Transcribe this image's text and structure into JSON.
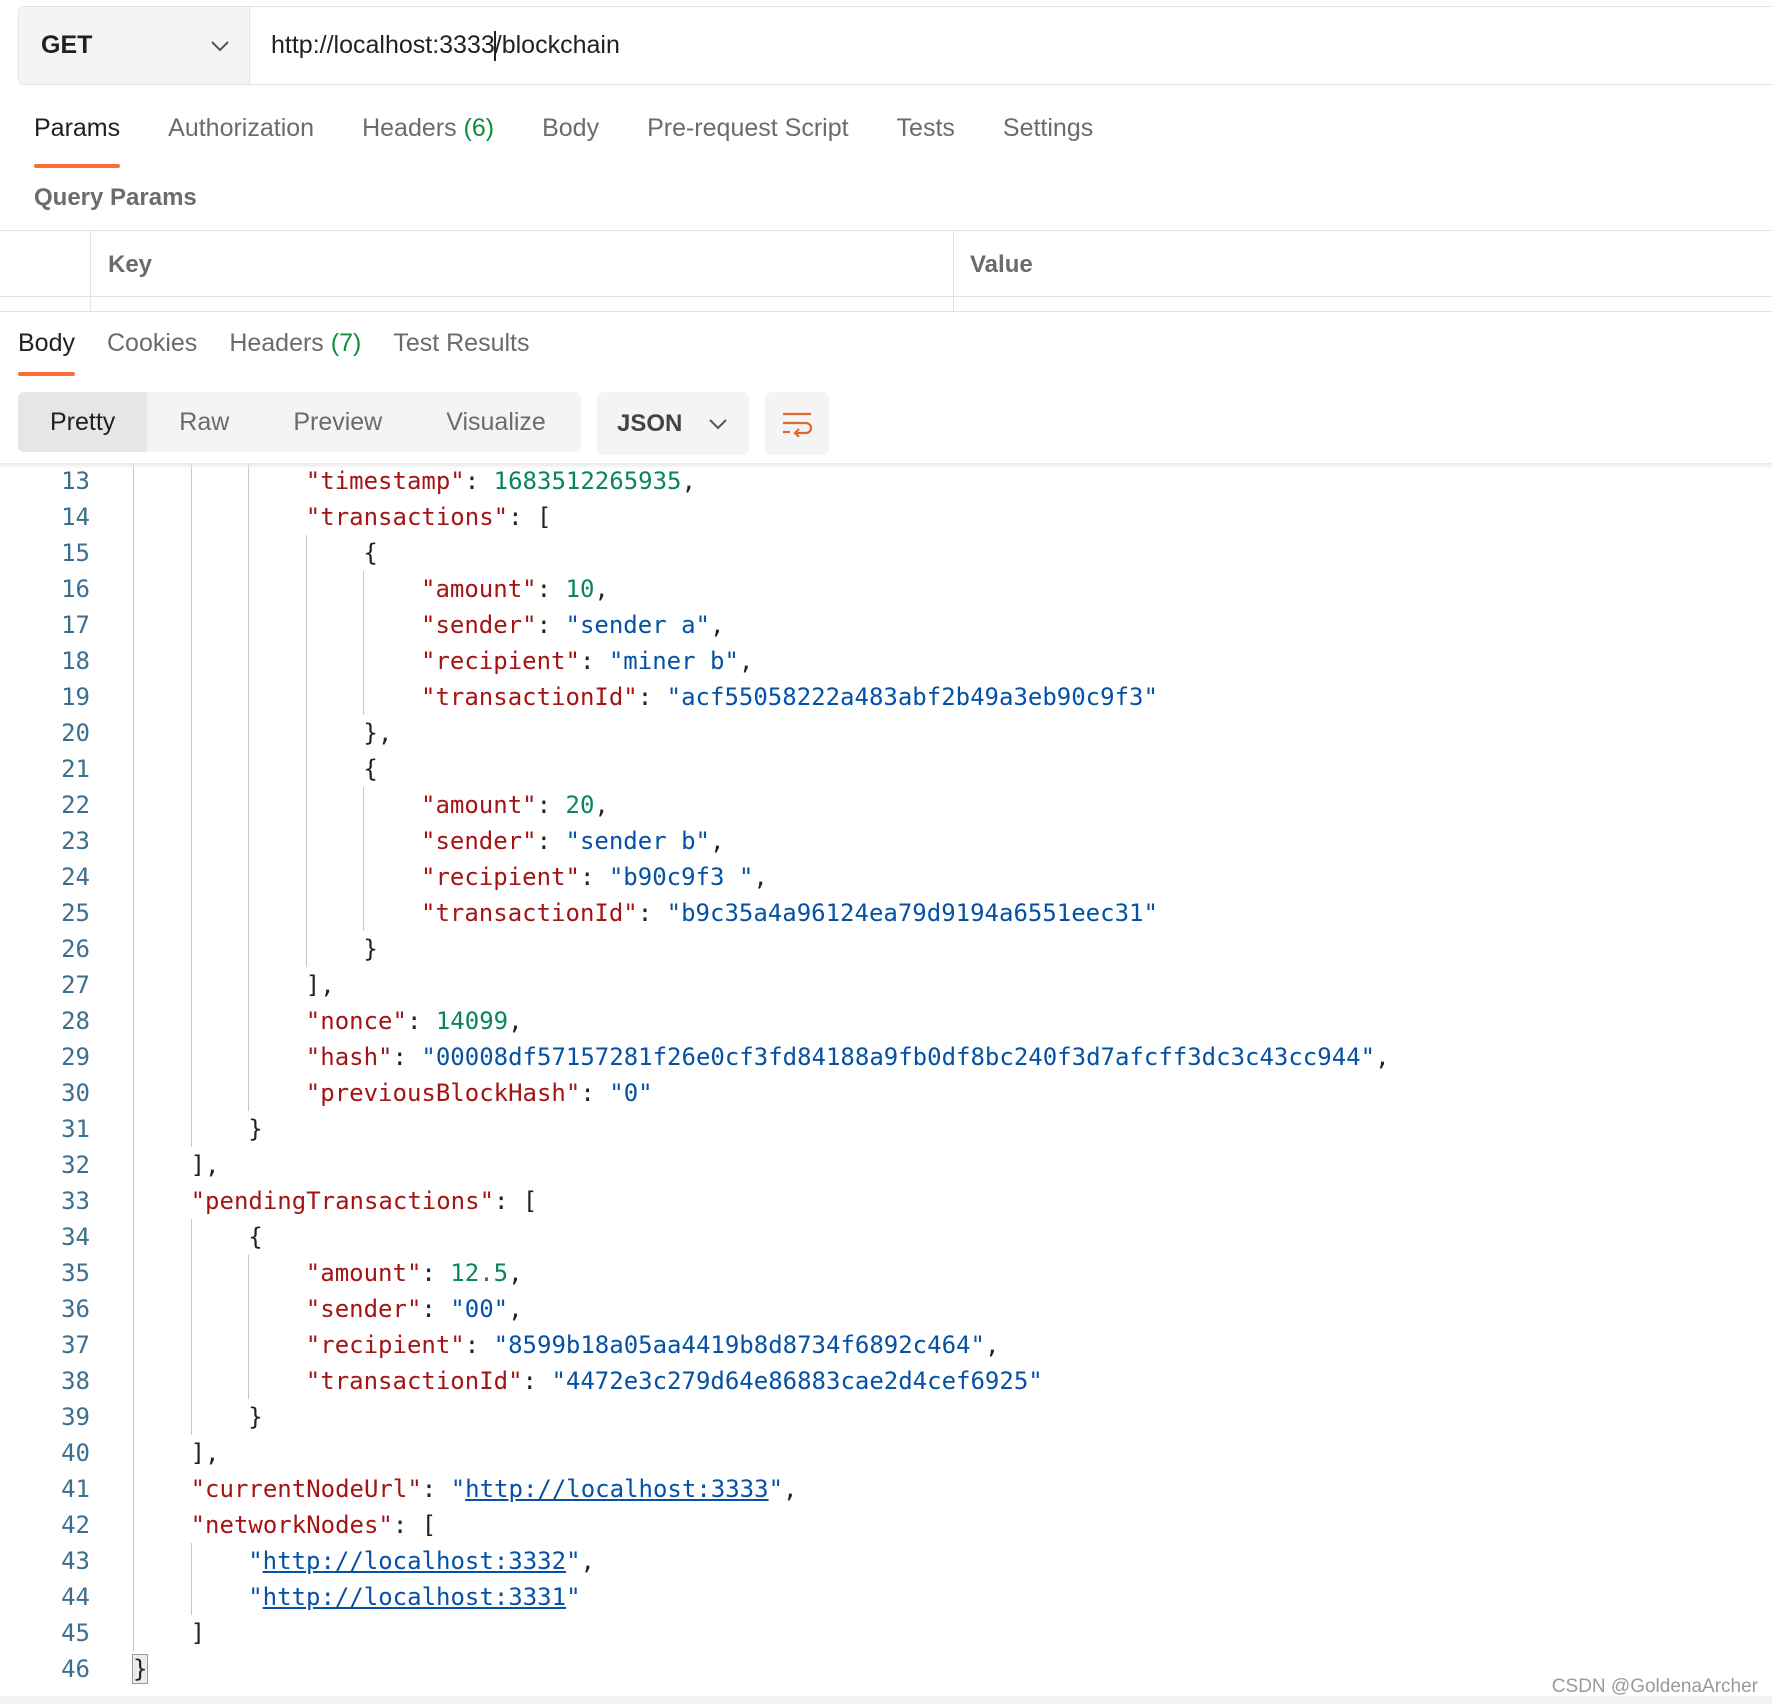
{
  "request": {
    "method": "GET",
    "url_before_cursor": "http://localhost:3333",
    "url_after_cursor": "/blockchain"
  },
  "request_tabs": [
    {
      "label": "Params",
      "count": ""
    },
    {
      "label": "Authorization",
      "count": ""
    },
    {
      "label": "Headers",
      "count": "(6)"
    },
    {
      "label": "Body",
      "count": ""
    },
    {
      "label": "Pre-request Script",
      "count": ""
    },
    {
      "label": "Tests",
      "count": ""
    },
    {
      "label": "Settings",
      "count": ""
    }
  ],
  "query_params": {
    "title": "Query Params",
    "col_key": "Key",
    "col_value": "Value"
  },
  "response_tabs": [
    {
      "label": "Body",
      "count": ""
    },
    {
      "label": "Cookies",
      "count": ""
    },
    {
      "label": "Headers",
      "count": "(7)"
    },
    {
      "label": "Test Results",
      "count": ""
    }
  ],
  "view_modes": [
    "Pretty",
    "Raw",
    "Preview",
    "Visualize"
  ],
  "format": "JSON",
  "icons": {
    "method_dropdown": "chevron-down-icon",
    "format_dropdown": "chevron-down-icon",
    "wrap": "wrap-lines-icon"
  },
  "colors": {
    "accent": "#ff6c37",
    "count": "#0a8f3c",
    "json_key": "#a31515",
    "json_string": "#0451a5",
    "json_number": "#098658"
  },
  "code_lines": [
    {
      "n": "13",
      "indent": 3,
      "parts": [
        [
          "k",
          "\"timestamp\""
        ],
        [
          "p",
          ": "
        ],
        [
          "n",
          "1683512265935"
        ],
        [
          "p",
          ","
        ]
      ]
    },
    {
      "n": "14",
      "indent": 3,
      "parts": [
        [
          "k",
          "\"transactions\""
        ],
        [
          "p",
          ": ["
        ]
      ]
    },
    {
      "n": "15",
      "indent": 4,
      "parts": [
        [
          "p",
          "{"
        ]
      ]
    },
    {
      "n": "16",
      "indent": 5,
      "parts": [
        [
          "k",
          "\"amount\""
        ],
        [
          "p",
          ": "
        ],
        [
          "n",
          "10"
        ],
        [
          "p",
          ","
        ]
      ]
    },
    {
      "n": "17",
      "indent": 5,
      "parts": [
        [
          "k",
          "\"sender\""
        ],
        [
          "p",
          ": "
        ],
        [
          "s",
          "\"sender a\""
        ],
        [
          "p",
          ","
        ]
      ]
    },
    {
      "n": "18",
      "indent": 5,
      "parts": [
        [
          "k",
          "\"recipient\""
        ],
        [
          "p",
          ": "
        ],
        [
          "s",
          "\"miner b\""
        ],
        [
          "p",
          ","
        ]
      ]
    },
    {
      "n": "19",
      "indent": 5,
      "parts": [
        [
          "k",
          "\"transactionId\""
        ],
        [
          "p",
          ": "
        ],
        [
          "s",
          "\"acf55058222a483abf2b49a3eb90c9f3\""
        ]
      ]
    },
    {
      "n": "20",
      "indent": 4,
      "parts": [
        [
          "p",
          "},"
        ]
      ]
    },
    {
      "n": "21",
      "indent": 4,
      "parts": [
        [
          "p",
          "{"
        ]
      ]
    },
    {
      "n": "22",
      "indent": 5,
      "parts": [
        [
          "k",
          "\"amount\""
        ],
        [
          "p",
          ": "
        ],
        [
          "n",
          "20"
        ],
        [
          "p",
          ","
        ]
      ]
    },
    {
      "n": "23",
      "indent": 5,
      "parts": [
        [
          "k",
          "\"sender\""
        ],
        [
          "p",
          ": "
        ],
        [
          "s",
          "\"sender b\""
        ],
        [
          "p",
          ","
        ]
      ]
    },
    {
      "n": "24",
      "indent": 5,
      "parts": [
        [
          "k",
          "\"recipient\""
        ],
        [
          "p",
          ": "
        ],
        [
          "s",
          "\"b90c9f3 \""
        ],
        [
          "p",
          ","
        ]
      ]
    },
    {
      "n": "25",
      "indent": 5,
      "parts": [
        [
          "k",
          "\"transactionId\""
        ],
        [
          "p",
          ": "
        ],
        [
          "s",
          "\"b9c35a4a96124ea79d9194a6551eec31\""
        ]
      ]
    },
    {
      "n": "26",
      "indent": 4,
      "parts": [
        [
          "p",
          "}"
        ]
      ]
    },
    {
      "n": "27",
      "indent": 3,
      "parts": [
        [
          "p",
          "],"
        ]
      ]
    },
    {
      "n": "28",
      "indent": 3,
      "parts": [
        [
          "k",
          "\"nonce\""
        ],
        [
          "p",
          ": "
        ],
        [
          "n",
          "14099"
        ],
        [
          "p",
          ","
        ]
      ]
    },
    {
      "n": "29",
      "indent": 3,
      "parts": [
        [
          "k",
          "\"hash\""
        ],
        [
          "p",
          ": "
        ],
        [
          "s",
          "\"00008df57157281f26e0cf3fd84188a9fb0df8bc240f3d7afcff3dc3c43cc944\""
        ],
        [
          "p",
          ","
        ]
      ]
    },
    {
      "n": "30",
      "indent": 3,
      "parts": [
        [
          "k",
          "\"previousBlockHash\""
        ],
        [
          "p",
          ": "
        ],
        [
          "s",
          "\"0\""
        ]
      ]
    },
    {
      "n": "31",
      "indent": 2,
      "parts": [
        [
          "p",
          "}"
        ]
      ]
    },
    {
      "n": "32",
      "indent": 1,
      "parts": [
        [
          "p",
          "],"
        ]
      ]
    },
    {
      "n": "33",
      "indent": 1,
      "parts": [
        [
          "k",
          "\"pendingTransactions\""
        ],
        [
          "p",
          ": ["
        ]
      ]
    },
    {
      "n": "34",
      "indent": 2,
      "parts": [
        [
          "p",
          "{"
        ]
      ]
    },
    {
      "n": "35",
      "indent": 3,
      "parts": [
        [
          "k",
          "\"amount\""
        ],
        [
          "p",
          ": "
        ],
        [
          "n",
          "12.5"
        ],
        [
          "p",
          ","
        ]
      ]
    },
    {
      "n": "36",
      "indent": 3,
      "parts": [
        [
          "k",
          "\"sender\""
        ],
        [
          "p",
          ": "
        ],
        [
          "s",
          "\"00\""
        ],
        [
          "p",
          ","
        ]
      ]
    },
    {
      "n": "37",
      "indent": 3,
      "parts": [
        [
          "k",
          "\"recipient\""
        ],
        [
          "p",
          ": "
        ],
        [
          "s",
          "\"8599b18a05aa4419b8d8734f6892c464\""
        ],
        [
          "p",
          ","
        ]
      ]
    },
    {
      "n": "38",
      "indent": 3,
      "parts": [
        [
          "k",
          "\"transactionId\""
        ],
        [
          "p",
          ": "
        ],
        [
          "s",
          "\"4472e3c279d64e86883cae2d4cef6925\""
        ]
      ]
    },
    {
      "n": "39",
      "indent": 2,
      "parts": [
        [
          "p",
          "}"
        ]
      ]
    },
    {
      "n": "40",
      "indent": 1,
      "parts": [
        [
          "p",
          "],"
        ]
      ]
    },
    {
      "n": "41",
      "indent": 1,
      "parts": [
        [
          "k",
          "\"currentNodeUrl\""
        ],
        [
          "p",
          ": "
        ],
        [
          "s",
          "\""
        ],
        [
          "sl",
          "http://localhost:3333"
        ],
        [
          "s",
          "\""
        ],
        [
          "p",
          ","
        ]
      ]
    },
    {
      "n": "42",
      "indent": 1,
      "parts": [
        [
          "k",
          "\"networkNodes\""
        ],
        [
          "p",
          ": ["
        ]
      ]
    },
    {
      "n": "43",
      "indent": 2,
      "parts": [
        [
          "s",
          "\""
        ],
        [
          "sl",
          "http://localhost:3332"
        ],
        [
          "s",
          "\""
        ],
        [
          "p",
          ","
        ]
      ]
    },
    {
      "n": "44",
      "indent": 2,
      "parts": [
        [
          "s",
          "\""
        ],
        [
          "sl",
          "http://localhost:3331"
        ],
        [
          "s",
          "\""
        ]
      ]
    },
    {
      "n": "45",
      "indent": 1,
      "parts": [
        [
          "p",
          "]"
        ]
      ]
    },
    {
      "n": "46",
      "indent": 0,
      "parts": [
        [
          "ph",
          "}"
        ]
      ]
    }
  ],
  "watermark": "CSDN @GoldenaArcher"
}
